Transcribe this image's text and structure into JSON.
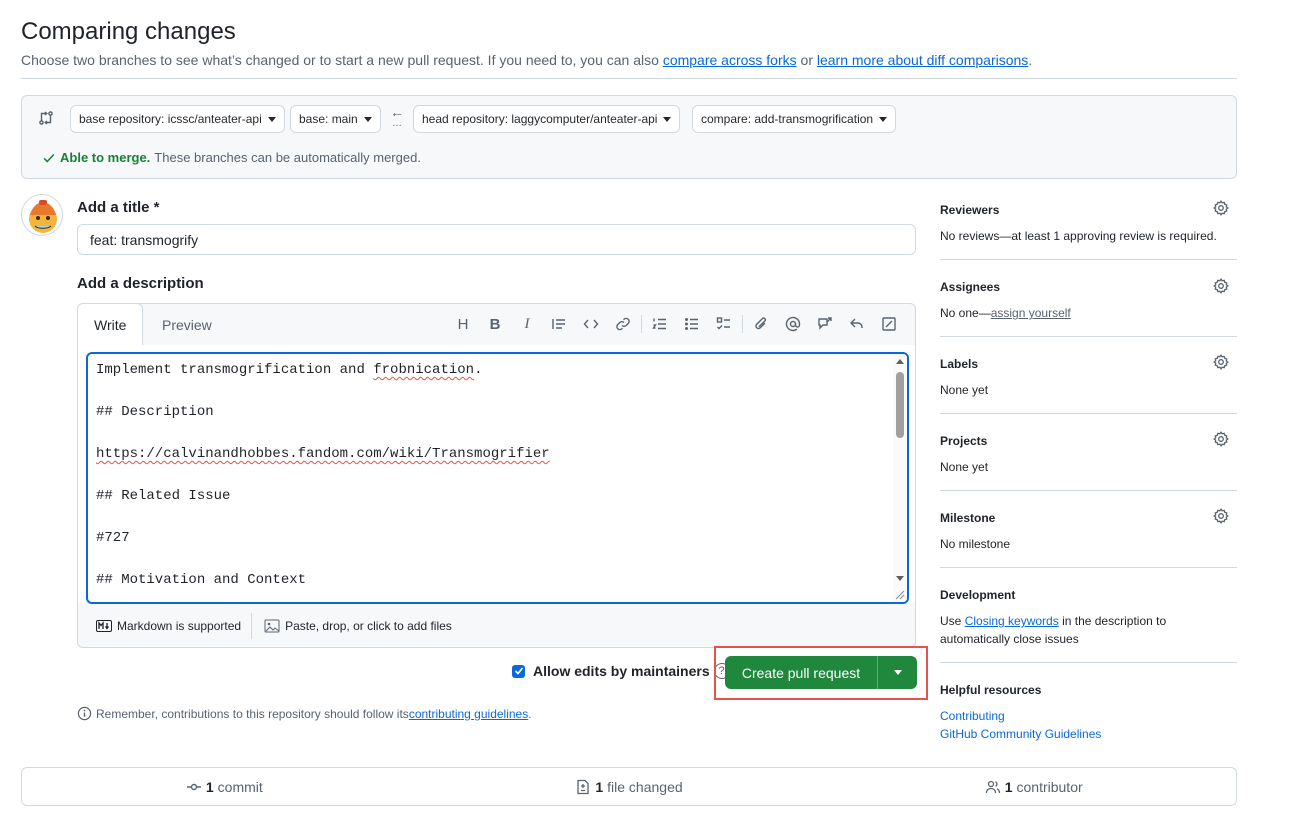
{
  "header": {
    "title": "Comparing changes",
    "subtitle_prefix": "Choose two branches to see what’s changed or to start a new pull request. If you need to, you can also ",
    "link_compare_forks": "compare across forks",
    "subtitle_or": " or ",
    "link_learn_more": "learn more about diff comparisons",
    "subtitle_end": "."
  },
  "compare": {
    "base_repository": "base repository: icssc/anteater-api",
    "base": "base: main",
    "arrow": "←",
    "arrow_dots": "…",
    "head_repository": "head repository: laggycomputer/anteater-api",
    "compare_branch": "compare: add-transmogrification",
    "merge_ok": "Able to merge.",
    "merge_text": "These branches can be automatically merged."
  },
  "form": {
    "title_label": "Add a title *",
    "title_value": "feat: transmogrify",
    "description_label": "Add a description",
    "tab_write": "Write",
    "tab_preview": "Preview",
    "toolbar_heading_glyph": "H",
    "toolbar_bold_glyph": "B",
    "toolbar_italic_glyph": "I",
    "body_lines": [
      {
        "plain": "Implement transmogrification and ",
        "squig": "frobnication",
        "rest": "."
      },
      {
        "plain": "## Description"
      },
      {
        "squig": "https://calvinandhobbes.fandom.com/wiki/Transmogrifier"
      },
      {
        "plain": "## Related Issue"
      },
      {
        "plain": "#727"
      },
      {
        "plain": "## Motivation and Context"
      }
    ],
    "markdown_supported": "Markdown is supported",
    "attach_files": "Paste, drop, or click to add files",
    "allow_edits": "Allow edits by maintainers",
    "help_glyph": "?",
    "create_button": "Create pull request",
    "remember_prefix": "Remember, contributions to this repository should follow its ",
    "remember_link": "contributing guidelines",
    "remember_end": "."
  },
  "sidebar": {
    "reviewers_title": "Reviewers",
    "reviewers_text": "No reviews—at least 1 approving review is required.",
    "assignees_title": "Assignees",
    "assignees_text": "No one—",
    "assignees_link": "assign yourself",
    "labels_title": "Labels",
    "labels_text": "None yet",
    "projects_title": "Projects",
    "projects_text": "None yet",
    "milestone_title": "Milestone",
    "milestone_text": "No milestone",
    "development_title": "Development",
    "development_prefix": "Use ",
    "development_link": "Closing keywords",
    "development_suffix": " in the description to",
    "development_line2": "automatically close issues",
    "helpful_title": "Helpful resources",
    "helpful_links": [
      "Contributing",
      "GitHub Community Guidelines"
    ]
  },
  "summary": {
    "commits_count": "1",
    "commits_label": "commit",
    "files_count": "1",
    "files_label": "file changed",
    "contributors_count": "1",
    "contributors_label": "contributor"
  },
  "colors": {
    "accent": "#0969da",
    "success": "#1a7f37",
    "button_green": "#1f883d",
    "highlight_red": "#e5534b"
  }
}
